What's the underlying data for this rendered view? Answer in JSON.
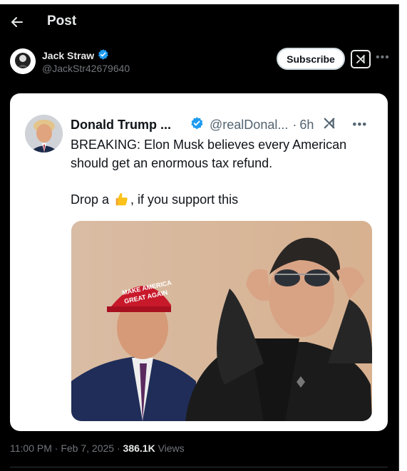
{
  "header": {
    "title": "Post",
    "back_icon": "arrow-left-icon"
  },
  "author": {
    "name": "Jack Straw",
    "handle": "@JackStr42679640",
    "verified": true,
    "subscribe_label": "Subscribe",
    "grok_icon": "grok-icon",
    "more_icon": "more-horizontal-icon"
  },
  "quoted_post": {
    "name": "Donald Trump ...",
    "handle": "@realDonal...",
    "separator": "·",
    "time": "6h",
    "verified": true,
    "text_line1": "BREAKING: Elon Musk believes every American should get an enormous tax refund.",
    "text_line2_before": "Drop a",
    "text_line2_after": ", if you support this",
    "emoji": "thumbs-up-icon",
    "image": "photo of two men, one in red cap, one in sunglasses"
  },
  "meta": {
    "time": "11:00 PM",
    "separator1": "·",
    "date": "Feb 7, 2025",
    "separator2": "·",
    "views_count": "386.1K",
    "views_label": "Views"
  },
  "colors": {
    "background": "#000000",
    "text_primary": "#e7e9ea",
    "text_secondary": "#71767b",
    "verified_blue": "#1d9bf0",
    "card_bg": "#ffffff"
  }
}
